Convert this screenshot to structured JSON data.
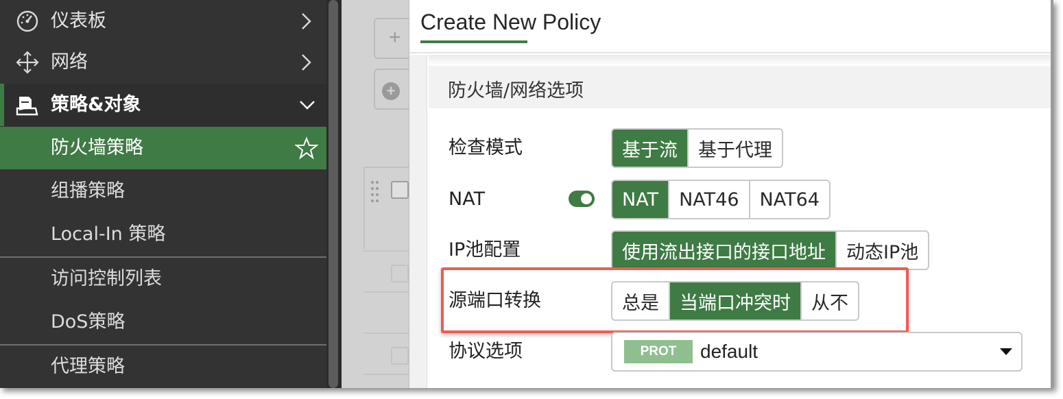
{
  "sidebar": {
    "items": [
      {
        "label": "仪表板",
        "icon": "dashboard-icon",
        "chevron": "chevron-right"
      },
      {
        "label": "网络",
        "icon": "network-arrows-icon",
        "chevron": "chevron-right"
      },
      {
        "label": "策略&对象",
        "icon": "policy-objects-icon",
        "chevron": "chevron-down"
      },
      {
        "label": "防火墙策略",
        "active": true,
        "icon": "star-icon"
      },
      {
        "label": "组播策略"
      },
      {
        "label": "Local-In 策略"
      },
      {
        "label": "访问控制列表"
      },
      {
        "label": "DoS策略"
      },
      {
        "label": "代理策略"
      }
    ]
  },
  "dialog": {
    "title": "Create New Policy",
    "section_title": "防火墙/网络选项",
    "inspection_mode": {
      "label": "检查模式",
      "options": [
        "基于流",
        "基于代理"
      ],
      "selected": "基于流"
    },
    "nat": {
      "label": "NAT",
      "toggle_on": true,
      "options": [
        "NAT",
        "NAT46",
        "NAT64"
      ],
      "selected": "NAT"
    },
    "ip_pool": {
      "label": "IP池配置",
      "options": [
        "使用流出接口的接口地址",
        "动态IP池"
      ],
      "selected": "使用流出接口的接口地址"
    },
    "source_port_translation": {
      "label": "源端口转换",
      "options": [
        "总是",
        "当端口冲突时",
        "从不"
      ],
      "selected": "当端口冲突时"
    },
    "protocol_options": {
      "label": "协议选项",
      "badge": "PROT",
      "value": "default"
    }
  },
  "colors": {
    "accent": "#3f7b44",
    "sidebar_bg": "#333333",
    "highlight_border": "#ee5b52",
    "badge_bg": "#8fbf8f"
  }
}
